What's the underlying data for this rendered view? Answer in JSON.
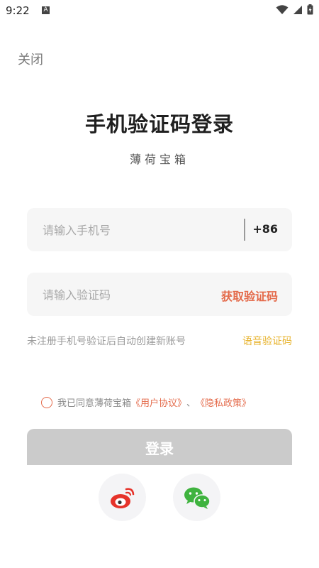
{
  "status_bar": {
    "time": "9:22",
    "notification_icon": "A",
    "icons": [
      "wifi-icon",
      "signal-icon",
      "battery-icon"
    ]
  },
  "header": {
    "close_label": "关闭"
  },
  "title": "手机验证码登录",
  "subtitle": "薄荷宝箱",
  "phone_field": {
    "placeholder": "请输入手机号",
    "country_code": "+86"
  },
  "code_field": {
    "placeholder": "请输入验证码",
    "get_code_label": "获取验证码"
  },
  "hint": {
    "text": "未注册手机号验证后自动创建新账号",
    "voice_code_label": "语音验证码"
  },
  "agreement": {
    "prefix": "我已同意薄荷宝箱",
    "user_agreement": "《用户协议》",
    "separator": "、",
    "privacy_policy": "《隐私政策》",
    "checked": false
  },
  "login_label": "登录",
  "social_login": {
    "icons": [
      "weibo-icon",
      "wechat-icon"
    ]
  },
  "colors": {
    "accent": "#e46a4a",
    "voice_accent": "#e7b22a",
    "disabled_button": "#cbcbcb",
    "field_bg": "#f6f6f6"
  }
}
